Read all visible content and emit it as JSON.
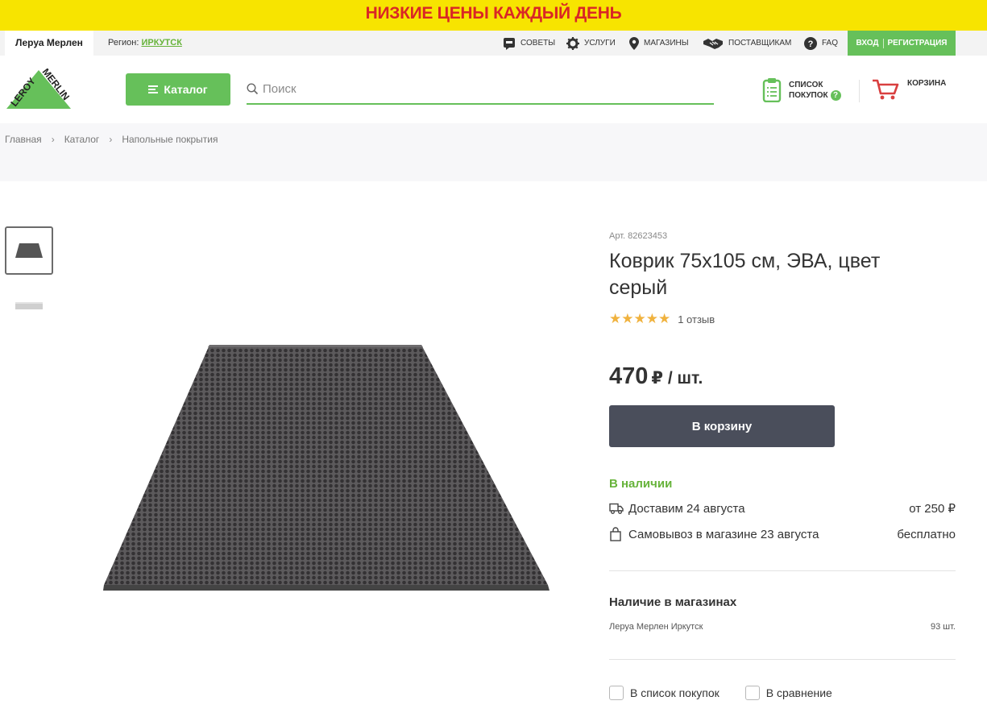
{
  "promo": {
    "text": "НИЗКИЕ ЦЕНЫ КАЖДЫЙ ДЕНЬ"
  },
  "topbar": {
    "store_tab": "Леруа Мерлен",
    "region_label": "Регион:",
    "region_value": "ИРКУТСК",
    "nav": [
      {
        "label": "СОВЕТЫ",
        "icon": "chat-icon"
      },
      {
        "label": "УСЛУГИ",
        "icon": "gear-icon"
      },
      {
        "label": "МАГАЗИНЫ",
        "icon": "map-pin-icon"
      },
      {
        "label": "ПОСТАВЩИКАМ",
        "icon": "handshake-icon"
      },
      {
        "label": "FAQ",
        "icon": "question-icon"
      }
    ],
    "login": "ВХОД",
    "register": "РЕГИСТРАЦИЯ"
  },
  "header": {
    "logo_text_1": "LEROY",
    "logo_text_2": "MERLIN",
    "catalog_label": "Каталог",
    "search_placeholder": "Поиск",
    "shopping_list_line1": "СПИСОК",
    "shopping_list_line2": "ПОКУПОК",
    "help_mark": "?",
    "cart_label": "КОРЗИНА"
  },
  "breadcrumbs": [
    "Главная",
    "Каталог",
    "Напольные покрытия"
  ],
  "product": {
    "article": "Арт. 82623453",
    "title": "Коврик 75x105 см, ЭВА, цвет серый",
    "rating": 5,
    "stars": "★★★★★",
    "reviews": "1 отзыв",
    "price": "470",
    "price_unit": "₽ / шт.",
    "buy_label": "В корзину",
    "stock_status": "В наличии",
    "delivery_label": "Доставим 24 августа",
    "delivery_price": "от 250 ₽",
    "pickup_label": "Самовывоз в магазине 23 августа",
    "pickup_price": "бесплатно",
    "availability_heading": "Наличие в магазинах",
    "store_name": "Леруа Мерлен Иркутск",
    "store_qty": "93 шт.",
    "add_to_list": "В список покупок",
    "compare": "В сравнение"
  },
  "colors": {
    "brand_green": "#66c05a",
    "promo_yellow": "#f7e400",
    "promo_red": "#d92626",
    "buy_button": "#4a4e5b",
    "star": "#f0b23e"
  }
}
